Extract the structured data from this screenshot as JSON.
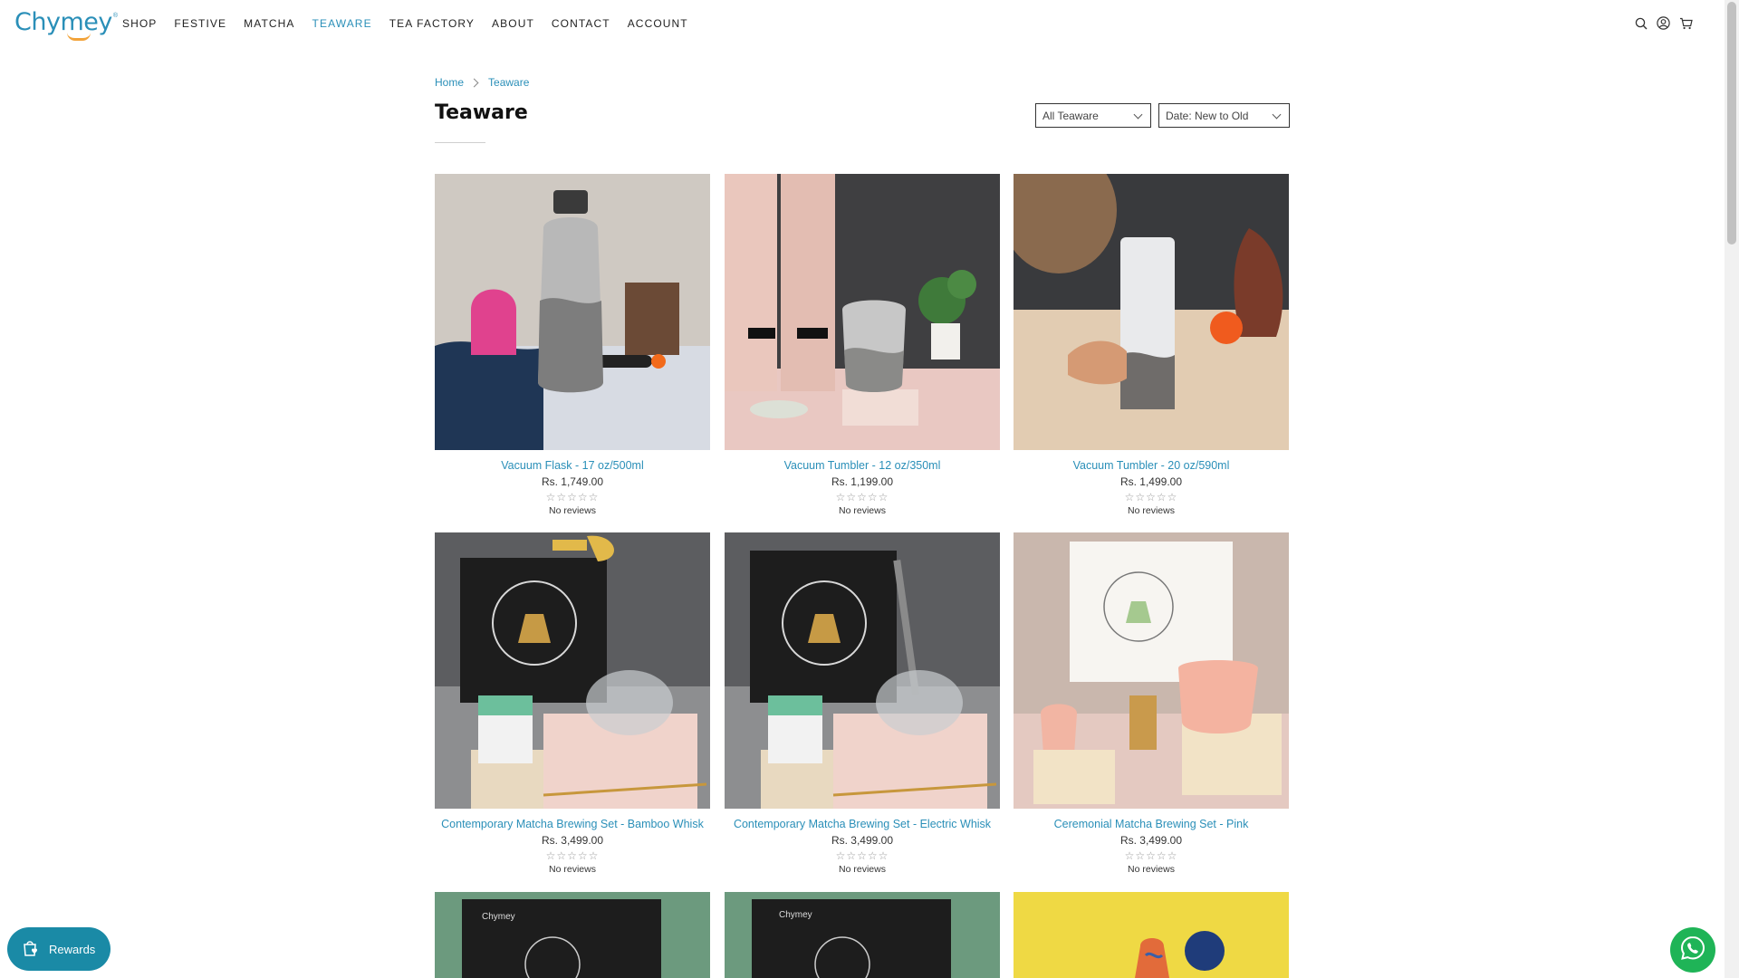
{
  "brand": {
    "logo_text": "Chymey",
    "logo_mark": "®"
  },
  "nav": {
    "items": [
      {
        "label": "SHOP"
      },
      {
        "label": "FESTIVE"
      },
      {
        "label": "MATCHA"
      },
      {
        "label": "TEAWARE",
        "active": true
      },
      {
        "label": "TEA FACTORY"
      },
      {
        "label": "ABOUT"
      },
      {
        "label": "CONTACT"
      },
      {
        "label": "ACCOUNT"
      }
    ],
    "icons": [
      "search-icon",
      "account-icon",
      "cart-icon"
    ]
  },
  "breadcrumb": {
    "home": "Home",
    "current": "Teaware"
  },
  "page": {
    "title": "Teaware"
  },
  "filters": {
    "category": "All Teaware",
    "sort": "Date: New to Old"
  },
  "products": [
    {
      "name": "Vacuum Flask - 17 oz/500ml",
      "price": "Rs. 1,749.00",
      "stars": "☆☆☆☆☆",
      "reviews": "No reviews"
    },
    {
      "name": "Vacuum Tumbler - 12 oz/350ml",
      "price": "Rs. 1,199.00",
      "stars": "☆☆☆☆☆",
      "reviews": "No reviews"
    },
    {
      "name": "Vacuum Tumbler - 20 oz/590ml",
      "price": "Rs. 1,499.00",
      "stars": "☆☆☆☆☆",
      "reviews": "No reviews"
    },
    {
      "name": "Contemporary Matcha Brewing Set - Bamboo Whisk",
      "price": "Rs. 3,499.00",
      "stars": "☆☆☆☆☆",
      "reviews": "No reviews"
    },
    {
      "name": "Contemporary Matcha Brewing Set - Electric Whisk",
      "price": "Rs. 3,499.00",
      "stars": "☆☆☆☆☆",
      "reviews": "No reviews"
    },
    {
      "name": "Ceremonial Matcha Brewing Set - Pink",
      "price": "Rs. 3,499.00",
      "stars": "☆☆☆☆☆",
      "reviews": "No reviews"
    }
  ],
  "partial_products": [
    "Chymey",
    "Chymey"
  ],
  "rewards": {
    "label": "Rewards"
  },
  "colors": {
    "accent": "#2a8fb8",
    "rewards_bg": "#1a8aa6",
    "whatsapp": "#1fb457",
    "logo_smile": "#f2a33a"
  }
}
